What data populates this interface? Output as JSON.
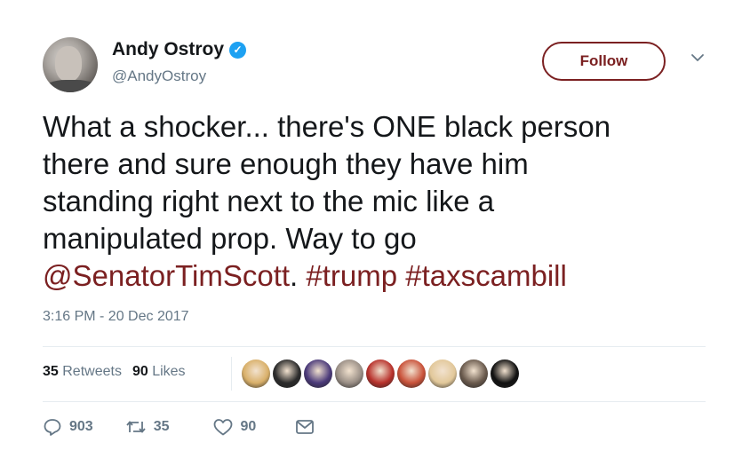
{
  "user": {
    "name": "Andy Ostroy",
    "handle": "@AndyOstroy",
    "verified_glyph": "✓"
  },
  "follow_label": "Follow",
  "tweet": {
    "line1": "What a shocker... there's ONE black person",
    "line2": "there and sure enough they have him",
    "line3": "standing right next to the mic like a",
    "line4": "manipulated prop. Way to go",
    "mention": "@SenatorTimScott",
    "period": ".",
    "hashtag1": "#trump",
    "hashtag2": "#taxscambill"
  },
  "timestamp": "3:16 PM - 20 Dec 2017",
  "stats": {
    "retweets_count": "35",
    "retweets_label": "Retweets",
    "likes_count": "90",
    "likes_label": "Likes"
  },
  "actions": {
    "replies": "903",
    "retweets": "35",
    "likes": "90"
  },
  "colors": {
    "accent": "#7b2021",
    "verified": "#1da1f2",
    "muted": "#657786",
    "text": "#14171a"
  },
  "likers": [
    {
      "name": "liker-1",
      "color": "#d9b06a"
    },
    {
      "name": "liker-2",
      "color": "#2b2b2b"
    },
    {
      "name": "liker-3",
      "color": "#4b3a7a"
    },
    {
      "name": "liker-4",
      "color": "#9a8f86"
    },
    {
      "name": "liker-5",
      "color": "#b8322c"
    },
    {
      "name": "liker-6",
      "color": "#c9523a"
    },
    {
      "name": "liker-7",
      "color": "#e2c89a"
    },
    {
      "name": "liker-8",
      "color": "#6a5a4d"
    },
    {
      "name": "liker-9",
      "color": "#111111"
    }
  ]
}
